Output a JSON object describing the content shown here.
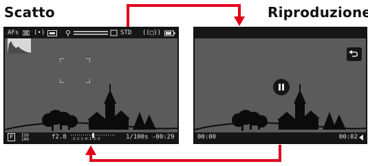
{
  "headings": {
    "left": "Scatto",
    "right": "Riproduzione"
  },
  "shooting": {
    "top": {
      "focus_mode": "AFs",
      "metering": "(•)",
      "dynamic_range": "STD",
      "stabilization": "((□))"
    },
    "bottom": {
      "mode_badge": "P",
      "iso_top": "ISO",
      "iso_bottom": "100",
      "aperture": "f2.8",
      "exposure_scale": "-3·2·1·0·1·2·3",
      "shutter": "1/100s",
      "remaining": "-00:29"
    }
  },
  "playback": {
    "elapsed": "00:00",
    "total": "00:02",
    "back_icon": "return-arrow-icon",
    "pause_icon": "pause-icon"
  },
  "colors": {
    "screen": "#5b5b5b",
    "bars": "#161616",
    "arrow": "#e1001a"
  }
}
